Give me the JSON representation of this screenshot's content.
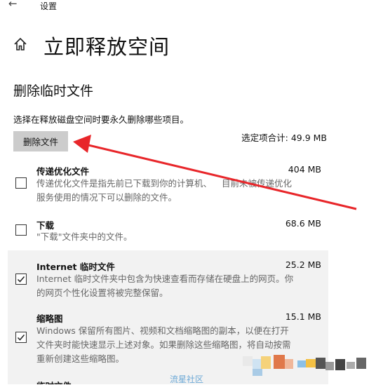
{
  "window": {
    "title": "设置",
    "back_icon": "back-arrow-icon"
  },
  "page": {
    "title": "立即释放空间",
    "home_icon": "home-icon"
  },
  "section": {
    "title": "删除临时文件",
    "description": "选择在释放磁盘空间时要永久删除哪些项目。",
    "delete_button": "删除文件",
    "total_label": "选定项合计: 49.9 MB"
  },
  "items": [
    {
      "name": "传递优化文件",
      "size": "404 MB",
      "checked": false,
      "desc1": "传递优化文件是指先前已下载到你的计算机、",
      "desc2": "目前未被传递优化",
      "desc3": "服务使用的情况下可以删除的文件。"
    },
    {
      "name": "下载",
      "size": "68.6 MB",
      "checked": false,
      "desc1": "\"下载\"文件夹中的文件。"
    },
    {
      "name": "Internet 临时文件",
      "size": "25.2 MB",
      "checked": true,
      "desc1": "Internet 临时文件夹中包含为快速查看而存储在硬盘上的网页。你",
      "desc2": "的网页个性化设置将被完整保留。"
    },
    {
      "name": "缩略图",
      "size": "15.1 MB",
      "checked": true,
      "desc1": "Windows 保留所有图片、视频和文档缩略图的副本，以便在打开",
      "desc2": "文件夹时能快速显示上述对象。如果删除这些缩略图，将自动按需",
      "desc3": "重新创建这些缩略图。"
    },
    {
      "name": "临时文件",
      "size": "",
      "checked": false
    }
  ],
  "watermark": {
    "text": "流星社区"
  },
  "colors": {
    "arrow": "#e8262a",
    "checked_bg": "#f2f2f2",
    "button_bg": "#cccccc",
    "watermark": "#6ba8d6"
  }
}
